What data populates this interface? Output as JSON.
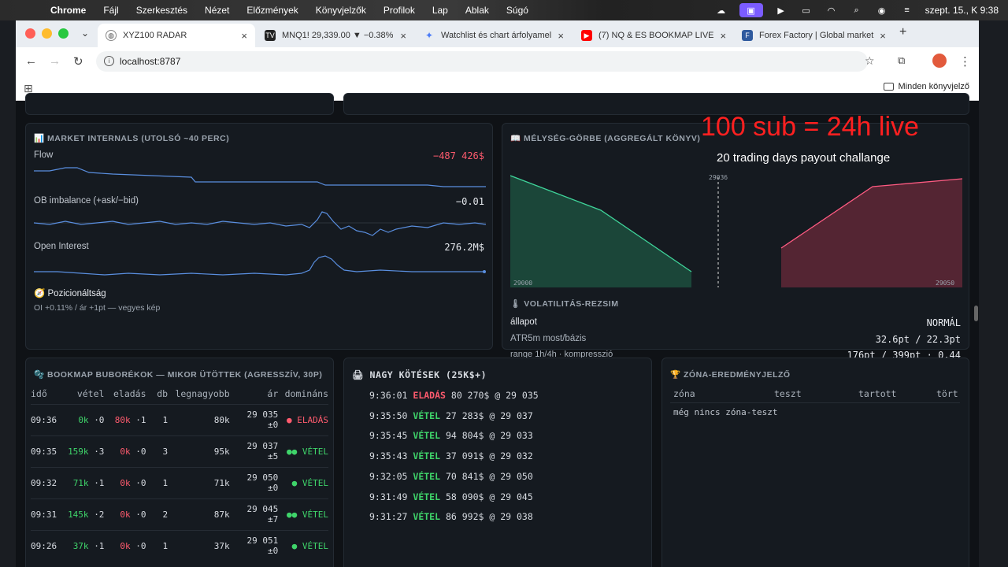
{
  "macbar": {
    "app": "Chrome",
    "menus": [
      "Fájl",
      "Szerkesztés",
      "Nézet",
      "Előzmények",
      "Könyvjelzők",
      "Profilok",
      "Lap",
      "Ablak",
      "Súgó"
    ],
    "clock": "szept. 15., K  9:38"
  },
  "tabs": [
    {
      "label": "XYZ100 RADAR",
      "icon": "globe-icon"
    },
    {
      "label": "MNQ1! 29,339.00 ▼ −0.38%",
      "icon": "tradingview-icon"
    },
    {
      "label": "Watchlist és chart árfolyamel",
      "icon": "gemini-icon"
    },
    {
      "label": "(7) NQ & ES BOOKMAP LIVE",
      "icon": "youtube-icon"
    },
    {
      "label": "Forex Factory | Global market",
      "icon": "forexfactory-icon"
    }
  ],
  "address": {
    "url": "localhost:8787"
  },
  "bookmarks": {
    "all_label": "Minden könyvjelző"
  },
  "internals": {
    "title": "📊 MARKET INTERNALS (UTOLSÓ ~40 PERC)",
    "flow_label": "Flow",
    "flow_value": "−487 426$",
    "ob_label": "OB imbalance (+ask/−bid)",
    "ob_value": "−0.01",
    "oi_label": "Open Interest",
    "oi_value": "276.2M$",
    "pos_label": "🧭 Pozicionáltság",
    "pos_desc": "OI +0.11% / ár +1pt — vegyes kép"
  },
  "depth": {
    "title": "📖 MÉLYSÉG-GÖRBE (AGGREGÁLT KÖNYV)",
    "left_tick": "29000",
    "right_tick": "29050",
    "mid_tick": "29036"
  },
  "volatility": {
    "title": "🌡 VOLATILITÁS-REZSIM",
    "state_label": "állapot",
    "state_value": "NORMÁL",
    "atr_label": "ATR5m most/bázis",
    "atr_value": "32.6pt / 22.3pt",
    "range_label": "range 1h/4h · kompresszió",
    "range_value": "176pt / 399pt · 0.44"
  },
  "bubbles": {
    "title": "🫧 BOOKMAP BUBORÉKOK — MIKOR ÜTÖTTEK (AGRESSZÍV, 30P)",
    "headers": [
      "idő",
      "vétel",
      "eladás",
      "db",
      "legnagyobb",
      "ár",
      "domináns"
    ],
    "rows": [
      {
        "time": "09:36",
        "buy": "0k",
        "buyn": "·0",
        "sell": "80k",
        "selln": "·1",
        "db": "1",
        "max": "80k",
        "price": "29 035",
        "pm": "±0",
        "dot": "●",
        "dom": "ELADÁS",
        "side": "sell"
      },
      {
        "time": "09:35",
        "buy": "159k",
        "buyn": "·3",
        "sell": "0k",
        "selln": "·0",
        "db": "3",
        "max": "95k",
        "price": "29 037",
        "pm": "±5",
        "dot": "●●",
        "dom": "VÉTEL",
        "side": "buy"
      },
      {
        "time": "09:32",
        "buy": "71k",
        "buyn": "·1",
        "sell": "0k",
        "selln": "·0",
        "db": "1",
        "max": "71k",
        "price": "29 050",
        "pm": "±0",
        "dot": "●",
        "dom": "VÉTEL",
        "side": "buy"
      },
      {
        "time": "09:31",
        "buy": "145k",
        "buyn": "·2",
        "sell": "0k",
        "selln": "·0",
        "db": "2",
        "max": "87k",
        "price": "29 045",
        "pm": "±7",
        "dot": "●●",
        "dom": "VÉTEL",
        "side": "buy"
      },
      {
        "time": "09:26",
        "buy": "37k",
        "buyn": "·1",
        "sell": "0k",
        "selln": "·0",
        "db": "1",
        "max": "37k",
        "price": "29 051",
        "pm": "±0",
        "dot": "●",
        "dom": "VÉTEL",
        "side": "buy"
      }
    ]
  },
  "trades": {
    "title": "🖨 NAGY KÖTÉSEK (25K$+)",
    "rows": [
      {
        "time": "9:36:01",
        "side": "ELADÁS",
        "amount": "80 270$ @ 29 035",
        "type": "sell"
      },
      {
        "time": "9:35:50",
        "side": "VÉTEL",
        "amount": "27 283$ @ 29 037",
        "type": "buy"
      },
      {
        "time": "9:35:45",
        "side": "VÉTEL",
        "amount": "94 804$ @ 29 033",
        "type": "buy"
      },
      {
        "time": "9:35:43",
        "side": "VÉTEL",
        "amount": "37 091$ @ 29 032",
        "type": "buy"
      },
      {
        "time": "9:32:05",
        "side": "VÉTEL",
        "amount": "70 841$ @ 29 050",
        "type": "buy"
      },
      {
        "time": "9:31:49",
        "side": "VÉTEL",
        "amount": "58 090$ @ 29 045",
        "type": "buy"
      },
      {
        "time": "9:31:27",
        "side": "VÉTEL",
        "amount": "86 992$ @ 29 038",
        "type": "buy"
      }
    ]
  },
  "zones": {
    "title": "🏆 ZÓNA-EREDMÉNYJELZŐ",
    "headers": [
      "zóna",
      "teszt",
      "tartott",
      "tört"
    ],
    "empty": "még nincs zóna-teszt"
  },
  "overlay": {
    "headline": "100 sub = 24h live",
    "subline": "20 trading days payout challange"
  },
  "colors": {
    "buy": "#3fd46a",
    "sell": "#ff5b6e",
    "line": "#5a8fe0"
  }
}
